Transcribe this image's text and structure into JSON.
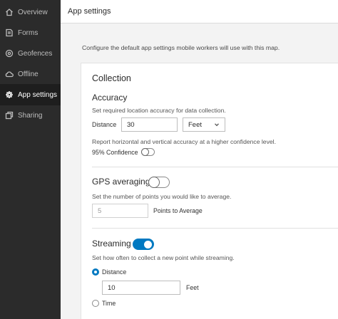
{
  "sidebar": {
    "items": [
      {
        "label": "Overview",
        "icon": "home-icon"
      },
      {
        "label": "Forms",
        "icon": "forms-icon"
      },
      {
        "label": "Geofences",
        "icon": "geofence-icon"
      },
      {
        "label": "Offline",
        "icon": "cloud-icon"
      },
      {
        "label": "App settings",
        "icon": "gear-icon",
        "active": true
      },
      {
        "label": "Sharing",
        "icon": "sharing-icon"
      }
    ]
  },
  "header": {
    "title": "App settings"
  },
  "intro": "Configure the default app settings mobile workers will use with this map.",
  "collection": {
    "title": "Collection",
    "accuracy": {
      "title": "Accuracy",
      "description": "Set required location accuracy for data collection.",
      "distance_label": "Distance",
      "distance_value": "30",
      "unit_value": "Feet",
      "report_text": "Report horizontal and vertical accuracy at a higher confidence level.",
      "confidence_label": "95% Confidence",
      "confidence_on": false
    },
    "gps": {
      "title": "GPS averaging",
      "enabled": false,
      "description": "Set the number of points you would like to average.",
      "points_placeholder": "5",
      "points_label": "Points to Average"
    },
    "streaming": {
      "title": "Streaming",
      "enabled": true,
      "description": "Set how often to collect a new point while streaming.",
      "distance_option": "Distance",
      "distance_value": "10",
      "distance_unit": "Feet",
      "time_option": "Time",
      "selected": "Distance"
    }
  },
  "colors": {
    "accent": "#0079c1",
    "sidebar": "#2b2b2b"
  }
}
